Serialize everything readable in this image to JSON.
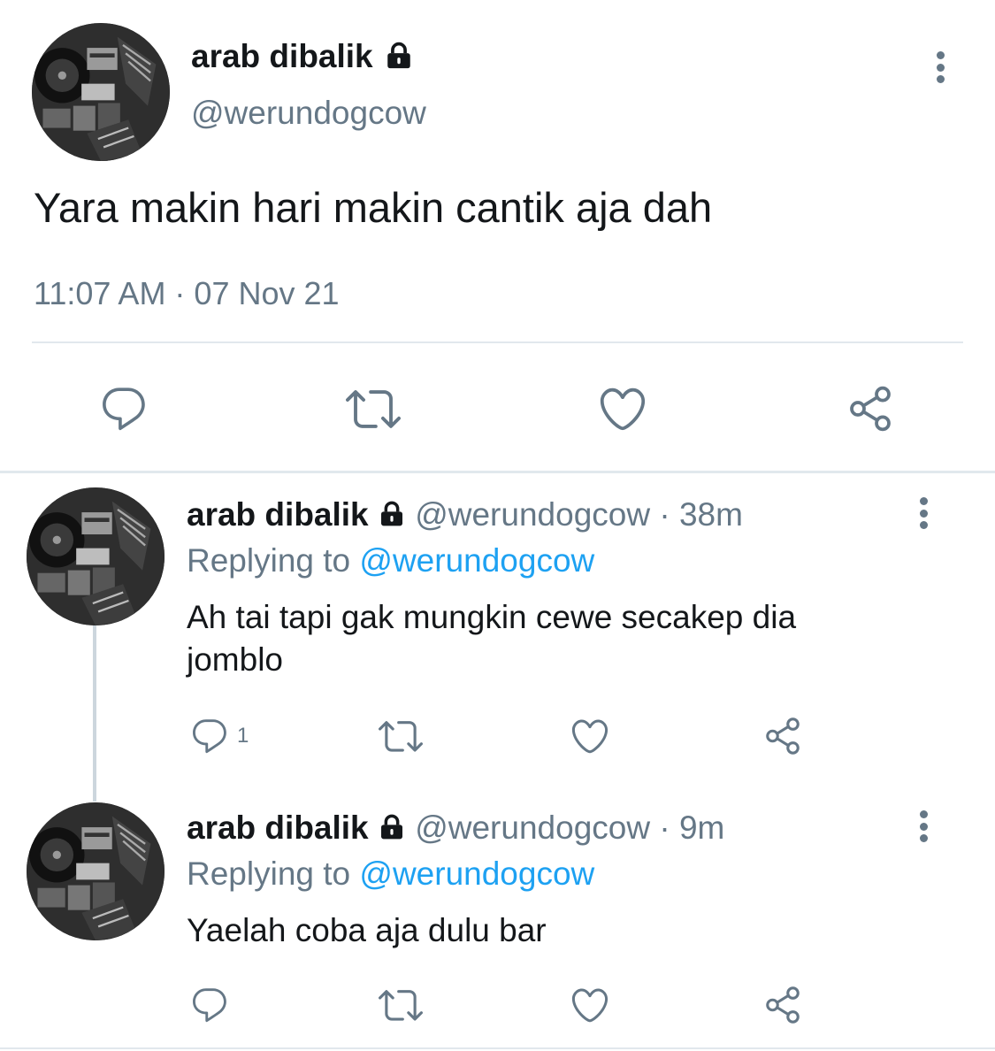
{
  "main_tweet": {
    "display_name": "arab dibalik",
    "handle": "@werundogcow",
    "text": "Yara makin hari makin cantik aja dah",
    "timestamp": "11:07 AM · 07 Nov 21"
  },
  "replies": [
    {
      "display_name": "arab dibalik",
      "handle": "@werundogcow",
      "time": "· 38m",
      "replying_prefix": "Replying to",
      "replying_to": "@werundogcow",
      "text_line1": "Ah tai tapi gak mungkin cewe secakep dia",
      "text_line2": "jomblo",
      "reply_count": "1"
    },
    {
      "display_name": "arab dibalik",
      "handle": "@werundogcow",
      "time": "· 9m",
      "replying_prefix": "Replying to",
      "replying_to": "@werundogcow",
      "text_line1": "Yaelah coba aja dulu bar",
      "reply_count": ""
    }
  ],
  "icons": [
    "lock-icon",
    "more-icon",
    "reply-icon",
    "retweet-icon",
    "like-icon",
    "share-icon"
  ],
  "colors": {
    "text": "#14171a",
    "muted": "#657786",
    "link": "#1da1f2",
    "divider": "#e1e8ed"
  }
}
